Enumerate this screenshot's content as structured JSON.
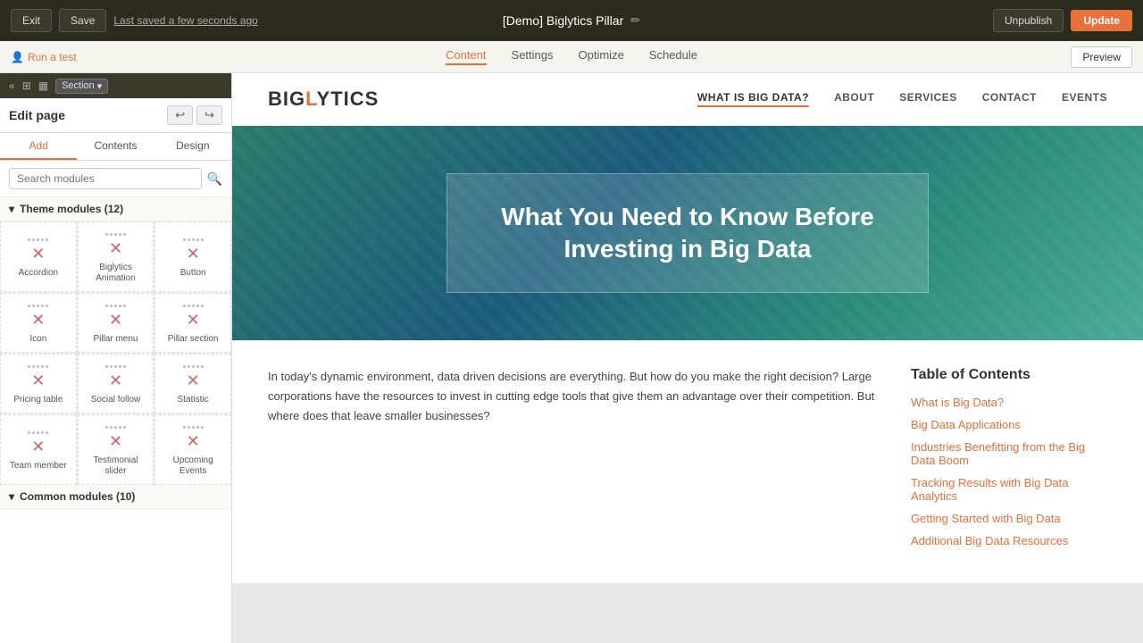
{
  "topBar": {
    "exitLabel": "Exit",
    "saveLabel": "Save",
    "savedText": "Last saved a few seconds ago",
    "pageTitle": "[Demo] Biglytics Pillar",
    "unpublishLabel": "Unpublish",
    "updateLabel": "Update"
  },
  "secondBar": {
    "runTestLabel": "Run a test",
    "tabs": [
      "Content",
      "Settings",
      "Optimize",
      "Schedule"
    ],
    "activeTab": "Content",
    "previewLabel": "Preview"
  },
  "sectionBar": {
    "label": "Section",
    "collapseIcon": "«"
  },
  "editPanel": {
    "title": "Edit page"
  },
  "panelTabs": [
    "Add",
    "Contents",
    "Design"
  ],
  "search": {
    "placeholder": "Search modules"
  },
  "themeModules": {
    "label": "Theme modules",
    "count": 12,
    "items": [
      {
        "name": "Accordion"
      },
      {
        "name": "Biglytics Animation"
      },
      {
        "name": "Button"
      },
      {
        "name": "Icon"
      },
      {
        "name": "Pillar menu"
      },
      {
        "name": "Pillar section"
      },
      {
        "name": "Pricing table"
      },
      {
        "name": "Social follow"
      },
      {
        "name": "Statistic"
      },
      {
        "name": "Team member"
      },
      {
        "name": "Testimonial slider"
      },
      {
        "name": "Upcoming Events"
      }
    ]
  },
  "commonModules": {
    "label": "Common modules",
    "count": 10
  },
  "site": {
    "logo": "BIGLYTICS",
    "nav": [
      "WHAT IS BIG DATA?",
      "ABOUT",
      "SERVICES",
      "CONTACT",
      "EVENTS"
    ]
  },
  "hero": {
    "title": "What You Need to Know Before\nInvesting in Big Data"
  },
  "body": {
    "intro": "In today's dynamic environment, data driven decisions are everything. But how do you make the right decision? Large corporations have the resources to invest in cutting edge tools that give them an advantage over their competition. But where does that leave smaller businesses?"
  },
  "toc": {
    "title": "Table of Contents",
    "links": [
      "What is Big Data?",
      "Big Data Applications",
      "Industries Benefitting from the Big Data Boom",
      "Tracking Results with Big Data Analytics",
      "Getting Started with Big Data",
      "Additional Big Data Resources"
    ]
  }
}
